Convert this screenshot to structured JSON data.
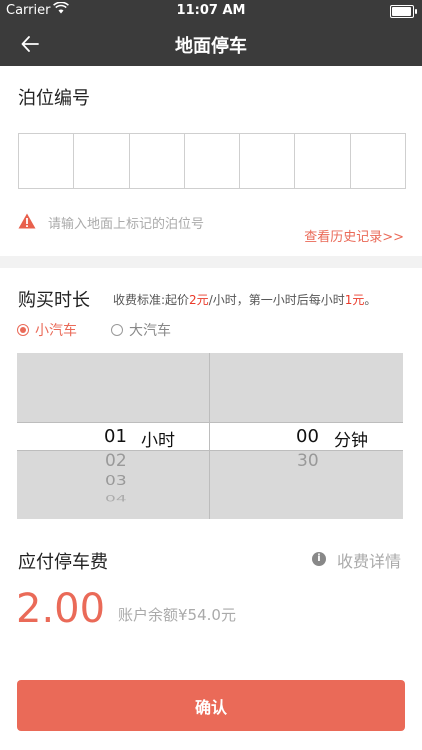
{
  "status_bar": {
    "carrier": "Carrier",
    "time": "11:07 AM"
  },
  "nav": {
    "title": "地面停车"
  },
  "berth": {
    "title": "泊位编号",
    "box_count": 7,
    "hint": "请输入地面上标记的泊位号",
    "history_link": "查看历史记录>>"
  },
  "purchase": {
    "title": "购买时长",
    "fee_rule": {
      "prefix": "收费标准:起价",
      "start_price": "2元",
      "middle": "/小时，第一小时后每小时",
      "hourly_price": "1元",
      "suffix": "。"
    },
    "vehicle_types": [
      {
        "label": "小汽车",
        "selected": true
      },
      {
        "label": "大汽车",
        "selected": false
      }
    ],
    "picker": {
      "hours_selected": "01",
      "hours_unit": "小时",
      "hours_below": [
        "02",
        "03",
        "04"
      ],
      "minutes_selected": "00",
      "minutes_unit": "分钟",
      "minutes_below": [
        "30"
      ]
    }
  },
  "payment": {
    "title": "应付停车费",
    "detail_link": "收费详情",
    "amount": "2.00",
    "balance": "账户余额¥54.0元"
  },
  "confirm_label": "确认",
  "colors": {
    "accent": "#ea6a58",
    "navbar": "#3b3b3b",
    "warn": "#e8604c"
  }
}
